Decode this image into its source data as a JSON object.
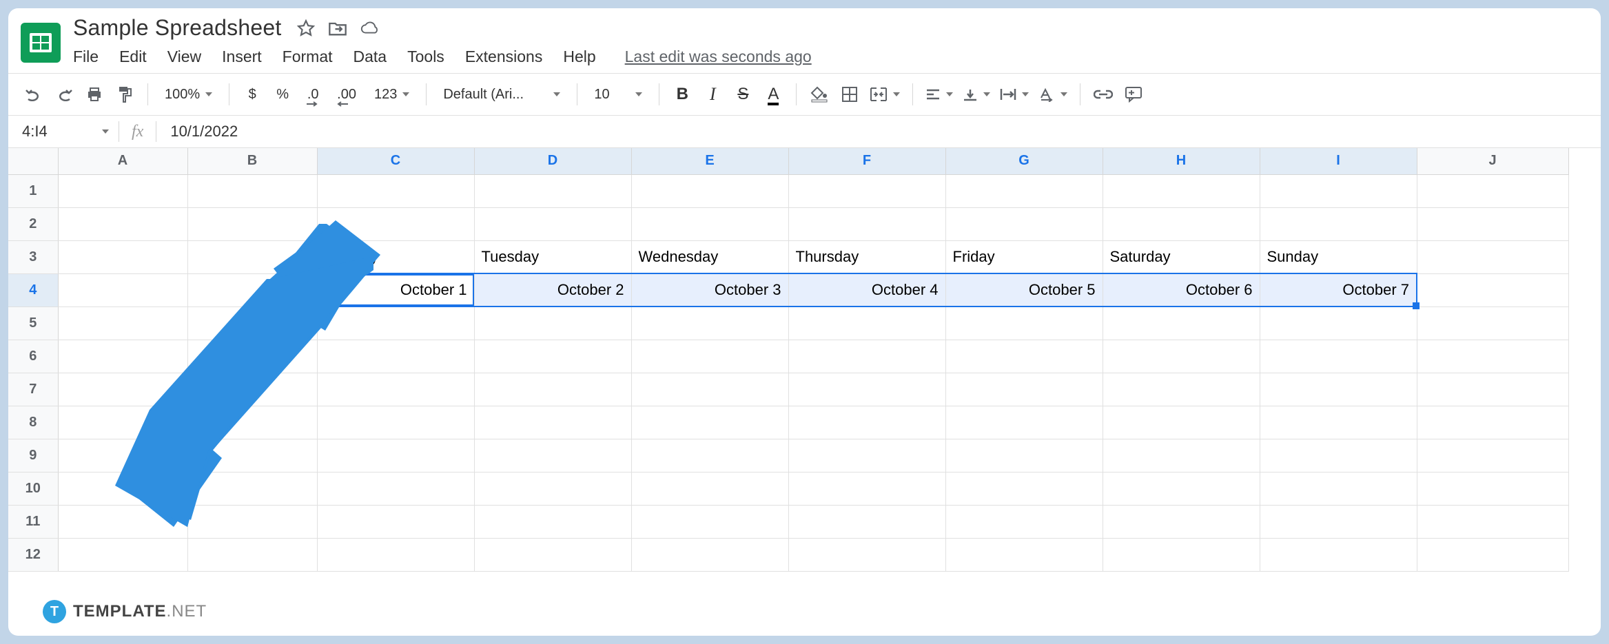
{
  "header": {
    "doc_title": "Sample Spreadsheet",
    "last_edit": "Last edit was seconds ago"
  },
  "menus": [
    "File",
    "Edit",
    "View",
    "Insert",
    "Format",
    "Data",
    "Tools",
    "Extensions",
    "Help"
  ],
  "toolbar": {
    "zoom": "100%",
    "currency": "$",
    "percent": "%",
    "dec_dec": ".0",
    "inc_dec": ".00",
    "more_formats": "123",
    "font": "Default (Ari...",
    "font_size": "10"
  },
  "formula_bar": {
    "cell_ref": "4:I4",
    "value": "10/1/2022"
  },
  "columns": [
    "A",
    "B",
    "C",
    "D",
    "E",
    "F",
    "G",
    "H",
    "I",
    "J"
  ],
  "rows": [
    "1",
    "2",
    "3",
    "4",
    "5",
    "6",
    "7",
    "8",
    "9",
    "10",
    "11",
    "12"
  ],
  "row3": {
    "C": "Monday",
    "D": "Tuesday",
    "E": "Wednesday",
    "F": "Thursday",
    "G": "Friday",
    "H": "Saturday",
    "I": "Sunday"
  },
  "row4": {
    "C": "October 1",
    "D": "October 2",
    "E": "October 3",
    "F": "October 4",
    "G": "October 5",
    "H": "October 6",
    "I": "October 7"
  },
  "selected_columns": [
    "C",
    "D",
    "E",
    "F",
    "G",
    "H",
    "I"
  ],
  "selected_row": "4",
  "watermark": {
    "badge": "T",
    "brand_bold": "TEMPLATE",
    "brand_light": ".NET"
  }
}
